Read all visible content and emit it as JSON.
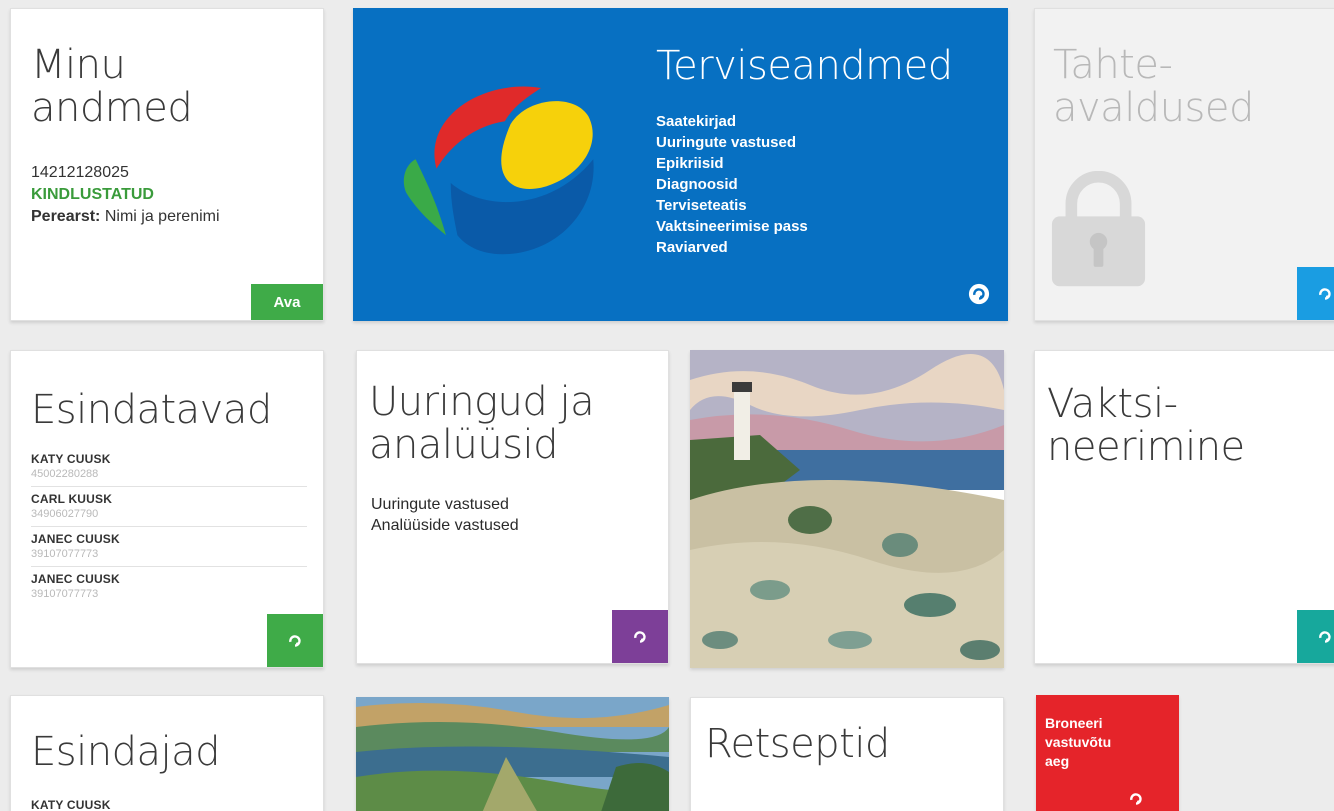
{
  "colors": {
    "blue": "#0770c2",
    "green": "#3fab48",
    "light_blue": "#1a9de2",
    "purple": "#7d3f98",
    "teal": "#17a89c",
    "red": "#e5242a",
    "status_green": "#3a9b3b"
  },
  "minu_andmed": {
    "title": "Minu\nandmed",
    "id_code": "14212128025",
    "status": "KINDLUSTATUD",
    "doctor_label": "Perearst:",
    "doctor_value": "Nimi ja perenimi",
    "open_label": "Ava"
  },
  "terviseandmed": {
    "title": "Terviseandmed",
    "links": [
      "Saatekirjad",
      "Uuringute vastused",
      "Epikriisid",
      "Diagnoosid",
      "Terviseteatis",
      "Vaktsineerimise pass",
      "Raviarved"
    ]
  },
  "tahteavaldused": {
    "title": "Tahte-\navaldused",
    "icon": "lock-icon"
  },
  "esindatavad": {
    "title": "Esindatavad",
    "people": [
      {
        "name": "KATY CUUSK",
        "code": "45002280288"
      },
      {
        "name": "CARL KUUSK",
        "code": "34906027790"
      },
      {
        "name": "JANEC CUUSK",
        "code": "39107077773"
      },
      {
        "name": "JANEC CUUSK",
        "code": "39107077773"
      }
    ]
  },
  "uuringud": {
    "title": "Uuringud ja\nanalüüsid",
    "links": [
      "Uuringute vastused",
      "Analüüside vastused"
    ]
  },
  "vaktsineerimine": {
    "title": "Vaktsi-\nneerimine"
  },
  "esindajad": {
    "title": "Esindajad",
    "people": [
      {
        "name": "KATY CUUSK"
      }
    ]
  },
  "retseptid": {
    "title": "Retseptid"
  },
  "broneeri": {
    "title": "Broneeri\nvastuvõtu\naeg"
  }
}
